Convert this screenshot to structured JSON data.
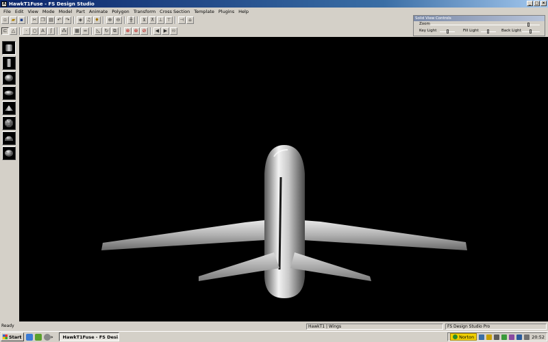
{
  "window": {
    "title": "HawkT1Fuse - FS Design Studio",
    "min": "_",
    "max": "□",
    "close": "×"
  },
  "menu": [
    "File",
    "Edit",
    "View",
    "Mode",
    "Model",
    "Part",
    "Animate",
    "Polygon",
    "Transform",
    "Cross Section",
    "Template",
    "Plugins",
    "Help"
  ],
  "toolbar1_icons": [
    "new-icon",
    "open-icon",
    "save-icon",
    "cut-icon",
    "copy-icon",
    "paste-icon",
    "undo-icon",
    "redo-icon",
    "properties-icon",
    "animate-icon",
    "wizard-icon",
    "zoom-in-icon",
    "zoom-out-icon",
    "grid-icon",
    "axis-icon",
    "snap-icon",
    "mirror-icon",
    "align-icon",
    "front-view-icon",
    "side-view-icon",
    "house-icon"
  ],
  "toolbar2_icons": [
    "select-icon",
    "triangle-icon",
    "point-icon",
    "circle-icon",
    "text-icon",
    "rotate-icon",
    "grid-icon",
    "line-icon",
    "shade-icon",
    "refresh-icon",
    "fit-icon",
    "record-icon",
    "stop-icon",
    "play-red-icon",
    "prev-icon",
    "next-icon",
    "binoculars-icon"
  ],
  "solid_view": {
    "title": "Solid View Controls",
    "zoom_label": "Zoom",
    "key_light_label": "Key Light",
    "fill_light_label": "Fill Light",
    "back_light_label": "Back Light",
    "zoom": 0.9,
    "key_light": 0.55,
    "fill_light": 0.5,
    "back_light": 0.5
  },
  "palette_tools": [
    "box-icon",
    "cylinder-icon",
    "sphere-icon",
    "ellipse-icon",
    "wedge-icon",
    "globe-icon",
    "dome-icon",
    "hemisphere-icon"
  ],
  "status": {
    "ready": "Ready",
    "part": "HawkT1 | Wings",
    "product": "FS Design Studio Pro"
  },
  "taskbar": {
    "start": "Start",
    "task": "HawkT1Fuse - FS Desi...",
    "norton": "Norton",
    "clock": "20:52"
  },
  "colors": {
    "titlebar": "#0a246a",
    "viewport": "#000000",
    "face": "#d4d0c8"
  }
}
